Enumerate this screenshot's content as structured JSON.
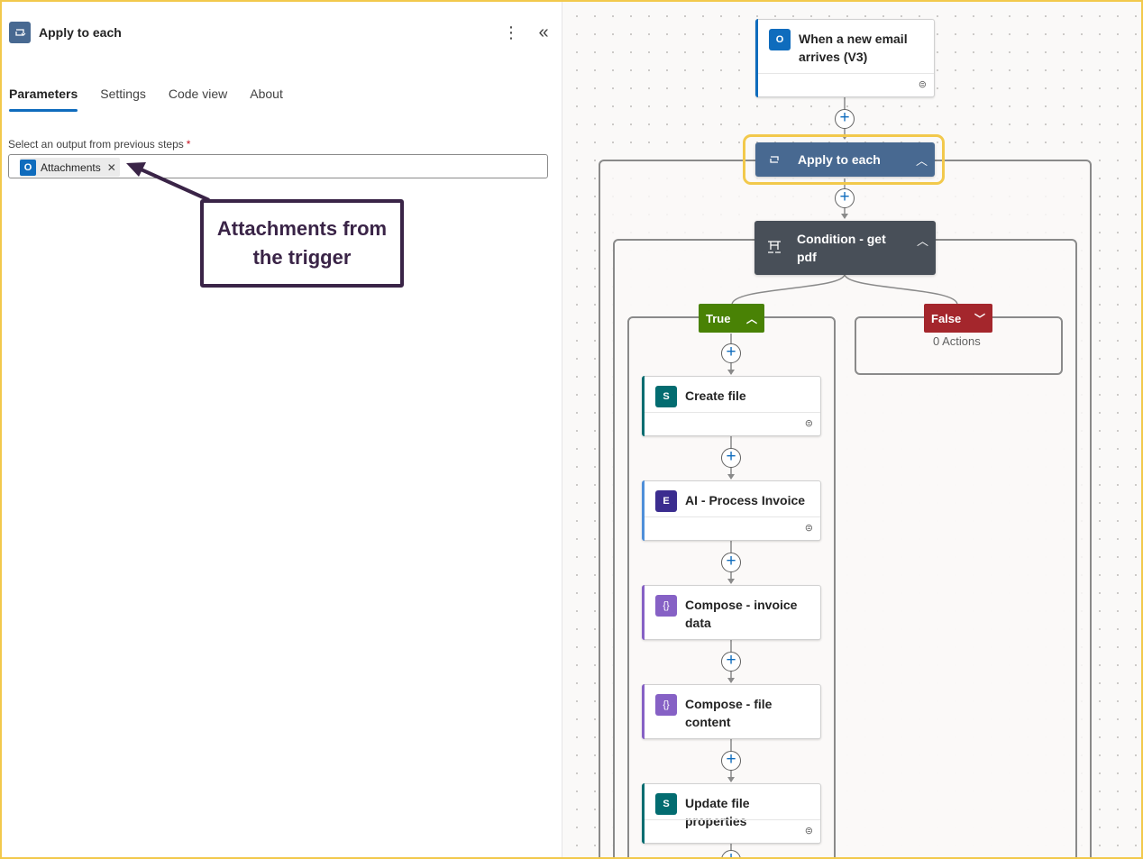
{
  "panel": {
    "title": "Apply to each",
    "icon": "loop-icon",
    "tabs": [
      {
        "label": "Parameters",
        "active": true
      },
      {
        "label": "Settings",
        "active": false
      },
      {
        "label": "Code view",
        "active": false
      },
      {
        "label": "About",
        "active": false
      }
    ],
    "field": {
      "label": "Select an output from previous steps",
      "required_mark": "*",
      "token": {
        "label": "Attachments",
        "icon": "outlook-icon"
      }
    }
  },
  "callout": {
    "line1": "Attachments from",
    "line2": "the trigger",
    "color": "#3a2447"
  },
  "flow": {
    "trigger": {
      "title_line1": "When a new email",
      "title_line2": "arrives (V3)",
      "icon": "outlook-icon"
    },
    "apply_each": {
      "title": "Apply to each",
      "icon": "loop-icon",
      "color": "#486991"
    },
    "condition": {
      "title_line1": "Condition - get",
      "title_line2": "pdf",
      "icon": "condition-icon",
      "color": "#484f58"
    },
    "true_branch": {
      "label": "True",
      "color": "#498205"
    },
    "false_branch": {
      "label": "False",
      "color": "#a4262c",
      "empty_text": "0 Actions"
    },
    "actions": [
      {
        "title_line1": "Create file",
        "title_line2": "",
        "icon": "sharepoint-icon",
        "accent": "#036c70"
      },
      {
        "title_line1": "AI - Process Invoice",
        "title_line2": "",
        "icon": "ai-builder-icon",
        "accent": "#4f8fd9"
      },
      {
        "title_line1": "Compose - invoice",
        "title_line2": "data",
        "icon": "compose-icon",
        "accent": "#8661c5"
      },
      {
        "title_line1": "Compose - file",
        "title_line2": "content",
        "icon": "compose-icon",
        "accent": "#8661c5"
      },
      {
        "title_line1": "Update file properties",
        "title_line2": "",
        "icon": "sharepoint-icon",
        "accent": "#036c70"
      }
    ]
  },
  "colors": {
    "highlight": "#f2c94c",
    "link": "#0f6cbd"
  }
}
